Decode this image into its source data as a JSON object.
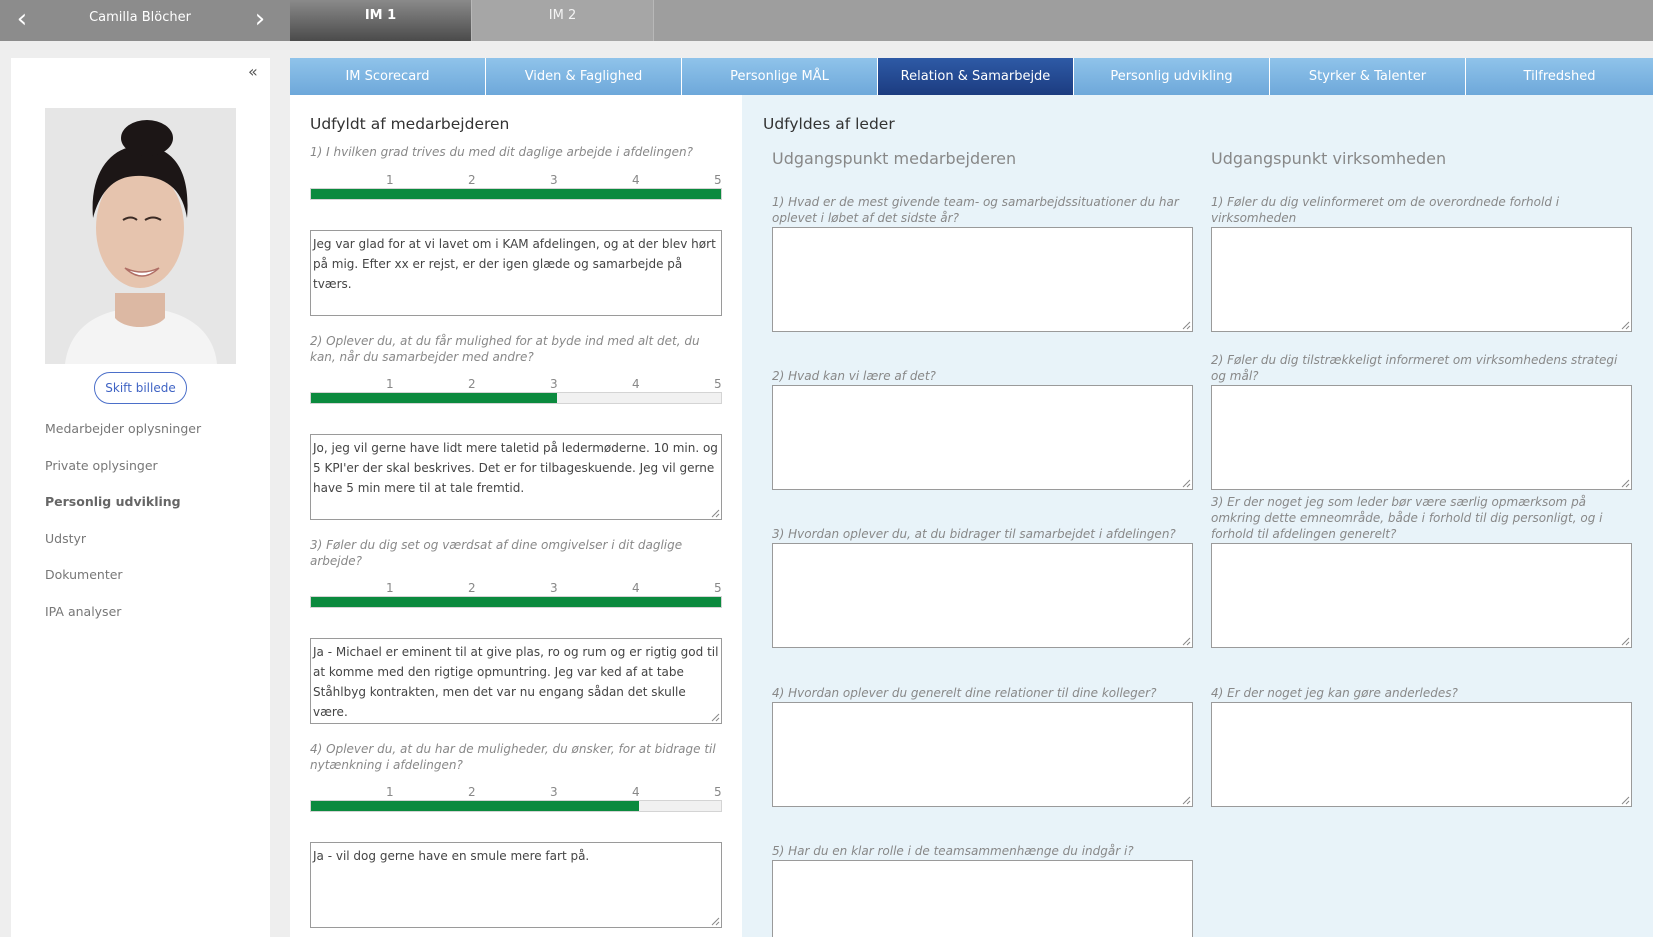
{
  "topbar": {
    "employee_name": "Camilla Blöcher",
    "prev_icon": "chevron-left-icon",
    "next_icon": "chevron-right-icon",
    "im_tabs": [
      {
        "label": "IM 1",
        "active": true
      },
      {
        "label": "IM 2",
        "active": false
      }
    ]
  },
  "sidebar": {
    "collapse_icon": "double-chevron-left-icon",
    "change_photo_label": "Skift billede",
    "menu": [
      {
        "label": "Medarbejder oplysninger",
        "active": false
      },
      {
        "label": "Private oplysinger",
        "active": false
      },
      {
        "label": "Personlig udvikling",
        "active": true
      },
      {
        "label": "Udstyr",
        "active": false
      },
      {
        "label": "Dokumenter",
        "active": false
      },
      {
        "label": "IPA analyser",
        "active": false
      }
    ]
  },
  "section_tabs": [
    {
      "label": "IM Scorecard",
      "active": false
    },
    {
      "label": "Viden & Faglighed",
      "active": false
    },
    {
      "label": "Personlige MÅL",
      "active": false
    },
    {
      "label": "Relation & Samarbejde",
      "active": true
    },
    {
      "label": "Personlig udvikling",
      "active": false
    },
    {
      "label": "Styrker & Talenter",
      "active": false
    },
    {
      "label": "Tilfredshed",
      "active": false
    }
  ],
  "employee_panel": {
    "title": "Udfyldt af medarbejderen",
    "scale_labels": [
      "1",
      "2",
      "3",
      "4",
      "5"
    ],
    "colors": {
      "fill": "#0b8a3e",
      "track": "#f1f1f1"
    },
    "questions": [
      {
        "text": "1) I hvilken grad trives du med dit daglige arbejde i afdelingen?",
        "rating": 5,
        "answer": "Jeg var glad for at vi lavet om i KAM afdelingen, og at der blev hørt på mig. Efter xx er rejst, er der igen glæde og samarbejde på tværs."
      },
      {
        "text": "2) Oplever du, at du får mulighed for at byde ind med alt det, du kan, når du samarbejder med andre?",
        "rating": 3,
        "answer": "Jo, jeg vil gerne have lidt mere taletid på ledermøderne. 10 min. og 5 KPI'er der skal beskrives. Det er for tilbageskuende. Jeg vil gerne have 5 min mere til at tale fremtid."
      },
      {
        "text": "3) Føler du dig set og værdsat af dine omgivelser i dit daglige arbejde?",
        "rating": 5,
        "answer": "Ja - Michael er eminent til at give plas, ro og rum og er rigtig god til at komme med den rigtige opmuntring. Jeg var ked af at tabe Ståhlbyg kontrakten, men det var nu engang sådan det skulle være."
      },
      {
        "text": "4) Oplever du, at du har de muligheder, du ønsker, for at bidrage til nytænkning i afdelingen?",
        "rating": 4,
        "answer": "Ja - vil dog gerne have en smule mere fart på."
      }
    ]
  },
  "leader_panel": {
    "title": "Udfyldes af leder",
    "employee_column": {
      "title": "Udgangspunkt medarbejderen",
      "questions": [
        "1) Hvad er de mest givende team- og samarbejdssituationer du har oplevet i løbet af det sidste år?",
        "2) Hvad kan vi lære af det?",
        "3) Hvordan oplever du, at du bidrager til samarbejdet i afdelingen?",
        "4) Hvordan oplever du generelt dine relationer til dine kolleger?",
        "5) Har du en klar rolle i de teamsammenhænge du indgår i?"
      ]
    },
    "company_column": {
      "title": "Udgangspunkt virksomheden",
      "questions": [
        "1) Føler du dig velinformeret om de overordnede forhold i virksomheden",
        "2) Føler du dig tilstrækkeligt informeret om virksomhedens strategi og mål?",
        "3) Er der noget jeg som leder bør være særlig opmærksom på omkring dette emneområde, både i forhold til dig personligt, og i forhold til afdelingen generelt?",
        "4) Er der noget jeg kan gøre anderledes?"
      ]
    }
  }
}
